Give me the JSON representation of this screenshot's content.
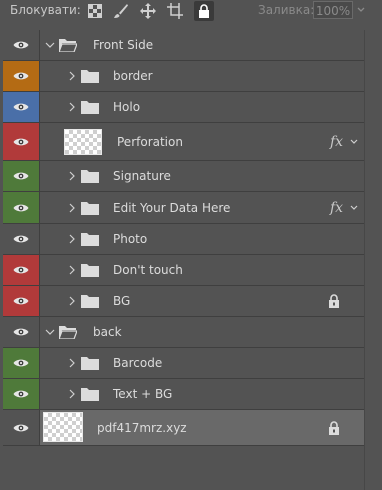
{
  "lockbar": {
    "label": "Блокувати:",
    "fill_label": "Заливка:",
    "fill_value": "100%"
  },
  "eye_colors": {
    "none": "#535353",
    "orange": "#b46b14",
    "blue": "#4a6fa8",
    "red": "#b13a3a",
    "green": "#4f7a3a"
  },
  "layers": [
    {
      "name": "Front Side",
      "type": "group",
      "expanded": true,
      "level": 0,
      "color": "none"
    },
    {
      "name": "border",
      "type": "group",
      "expanded": false,
      "level": 1,
      "color": "orange"
    },
    {
      "name": "Holo",
      "type": "group",
      "expanded": false,
      "level": 1,
      "color": "blue"
    },
    {
      "name": "Perforation",
      "type": "layer",
      "level": 1,
      "color": "red",
      "fx": true
    },
    {
      "name": "Signature",
      "type": "group",
      "expanded": false,
      "level": 1,
      "color": "green"
    },
    {
      "name": "Edit Your Data Here",
      "type": "group",
      "expanded": false,
      "level": 1,
      "color": "green",
      "fx": true
    },
    {
      "name": "Photo",
      "type": "group",
      "expanded": false,
      "level": 1,
      "color": "none"
    },
    {
      "name": "Don't touch",
      "type": "group",
      "expanded": false,
      "level": 1,
      "color": "red"
    },
    {
      "name": "BG",
      "type": "group",
      "expanded": false,
      "level": 1,
      "color": "red",
      "locked": true
    },
    {
      "name": "back",
      "type": "group",
      "expanded": true,
      "level": 0,
      "color": "none"
    },
    {
      "name": "Barcode",
      "type": "group",
      "expanded": false,
      "level": 1,
      "color": "green"
    },
    {
      "name": "Text + BG",
      "type": "group",
      "expanded": false,
      "level": 1,
      "color": "green"
    },
    {
      "name": "pdf417mrz.xyz",
      "type": "layer",
      "level": 0,
      "color": "none",
      "locked": true,
      "selected": true
    }
  ]
}
